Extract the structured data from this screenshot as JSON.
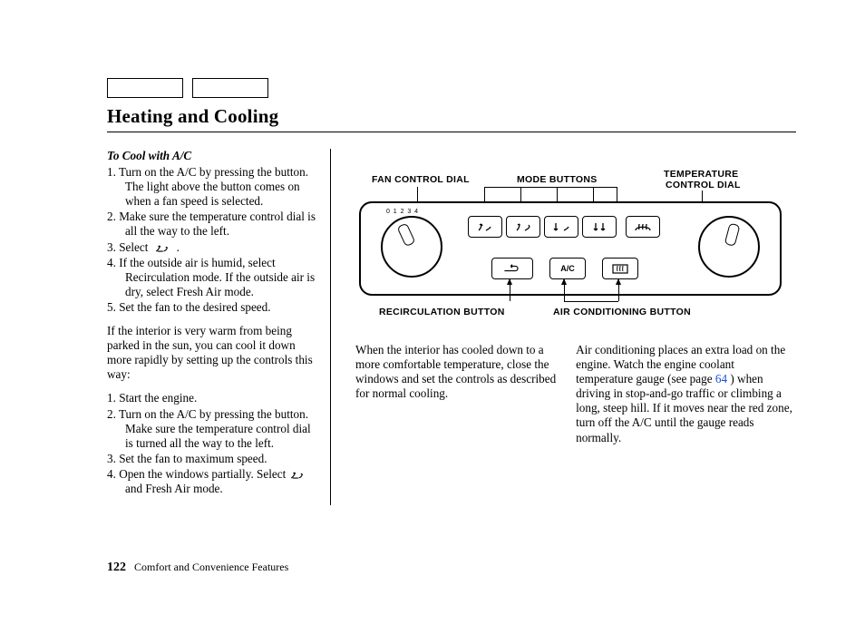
{
  "page": {
    "title": "Heating and Cooling",
    "number": "122",
    "section": "Comfort and Convenience Features"
  },
  "col1": {
    "subhead": "To Cool with A/C",
    "list1": [
      "Turn on the A/C by pressing the button. The light above the button comes on when a fan speed is selected.",
      "Make sure the temperature control dial is all the way to the left.",
      "Select            .",
      "If the outside air is humid, select Recirculation mode. If the outside air is dry, select Fresh Air mode.",
      "Set the fan to the desired speed."
    ],
    "para1": "If the interior is very warm from being parked in the sun, you can cool it down more rapidly by setting up the controls this way:",
    "list2": [
      "Start the engine.",
      "Turn on the A/C by pressing the button. Make sure the tempera­ture control dial is turned all the way to the left.",
      "Set the fan to maximum speed.",
      "Open the windows partially. Select             and Fresh Air mode."
    ]
  },
  "col2": {
    "para": "When the interior has cooled down to a more comfortable temperature, close the windows and set the controls as described for normal cooling."
  },
  "col3": {
    "para_a": "Air conditioning places an extra load on the engine. Watch the engine coolant temperature gauge (see page ",
    "pageref": "64",
    "para_b": " ) when driving in stop-and-go traffic or climbing a long, steep hill. If it moves near the red zone, turn off the A/C until the gauge reads normally."
  },
  "diagram": {
    "fan": "FAN CONTROL DIAL",
    "mode": "MODE BUTTONS",
    "temp1": "TEMPERATURE",
    "temp2": "CONTROL DIAL",
    "recirc": "RECIRCULATION BUTTON",
    "ac": "AIR CONDITIONING BUTTON",
    "ac_label": "A/C"
  }
}
